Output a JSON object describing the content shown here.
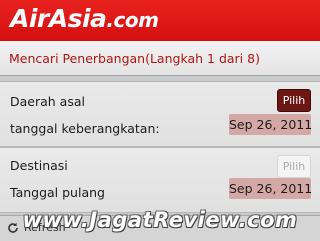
{
  "header": {
    "logo_text": "AirAsia",
    "logo_suffix": ".com"
  },
  "title_bar": {
    "title": "Mencari Penerbangan(Langkah 1 dari 8)"
  },
  "departure": {
    "origin_label": "Daerah asal",
    "select_button": "Pilih",
    "date_label": "tanggal keberangkatan:",
    "date_value": "Sep 26, 2011"
  },
  "return": {
    "destination_label": "Destinasi",
    "select_button": "Pilih",
    "date_label": "Tanggal pulang",
    "date_value": "Sep 26, 2011"
  },
  "footer": {
    "refresh_label": "Refresh",
    "icon": "refresh-icon"
  },
  "watermark": {
    "text": "www.JagatReview.com"
  },
  "colors": {
    "brand_red": "#e11b1b",
    "title_text": "#b01515",
    "active_button": "#6d1714",
    "date_field": "#d4a8a5"
  }
}
